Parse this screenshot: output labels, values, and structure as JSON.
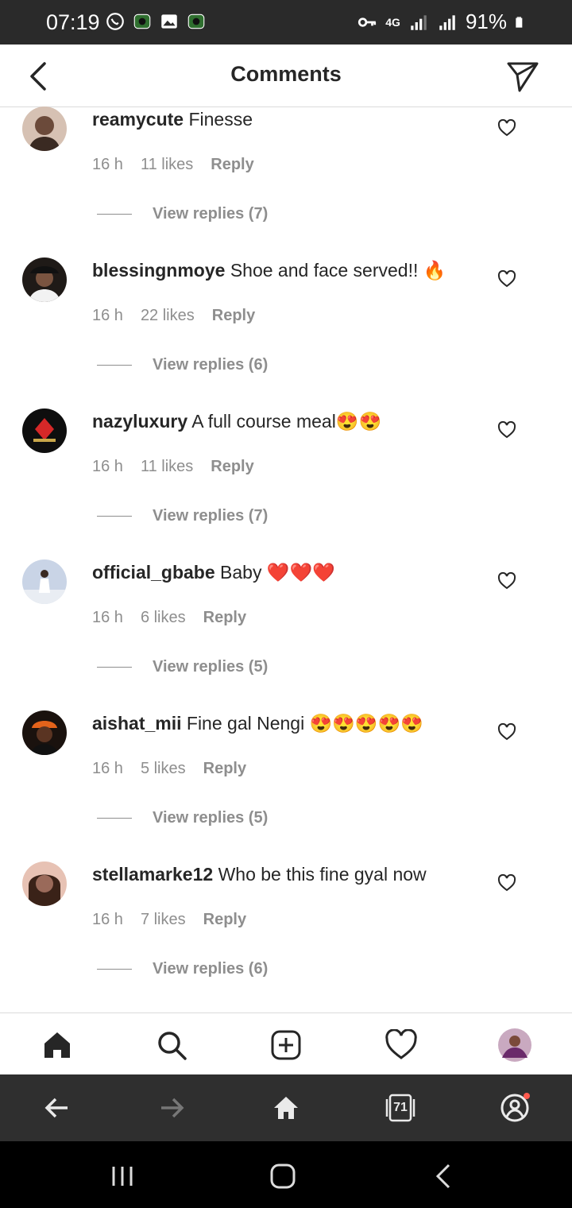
{
  "status_bar": {
    "time": "07:19",
    "battery": "91%",
    "network": "4G",
    "left_icons": [
      "whatsapp-icon",
      "app-icon",
      "gallery-icon",
      "app-icon"
    ],
    "right_icons": [
      "key-icon",
      "signal-icon",
      "signal-icon",
      "battery-icon"
    ]
  },
  "header": {
    "title": "Comments",
    "back_icon": "back-arrow-icon",
    "share_icon": "send-icon"
  },
  "comments": [
    {
      "user": "reamycute",
      "text": " Finesse",
      "time": "16 h",
      "likes": "11 likes",
      "reply": "Reply",
      "view_replies": "View replies (7)",
      "avatar_color": "#6b4a3a"
    },
    {
      "user": "blessingnmoye",
      "text": " Shoe and face served!! 🔥",
      "time": "16 h",
      "likes": "22 likes",
      "reply": "Reply",
      "view_replies": "View replies (6)",
      "avatar_color": "#2b2420"
    },
    {
      "user": "nazyluxury",
      "text": " A full course meal😍😍",
      "time": "16 h",
      "likes": "11 likes",
      "reply": "Reply",
      "view_replies": "View replies (7)",
      "avatar_color": "#111111"
    },
    {
      "user": "official_gbabe",
      "text": " Baby ❤️❤️❤️",
      "time": "16 h",
      "likes": "6 likes",
      "reply": "Reply",
      "view_replies": "View replies (5)",
      "avatar_color": "#c9d4e6"
    },
    {
      "user": "aishat_mii",
      "text": " Fine gal Nengi 😍😍😍😍😍",
      "time": "16 h",
      "likes": "5 likes",
      "reply": "Reply",
      "view_replies": "View replies (5)",
      "avatar_color": "#3a2418"
    },
    {
      "user": "stellamarke12",
      "text": " Who be this fine gyal now",
      "time": "16 h",
      "likes": "7 likes",
      "reply": "Reply",
      "view_replies": "View replies (6)",
      "avatar_color": "#9a6a5a"
    }
  ],
  "ig_nav": {
    "items": [
      "home-icon",
      "search-icon",
      "new-post-icon",
      "activity-heart-icon",
      "profile-avatar"
    ]
  },
  "browser_bar": {
    "tab_count": "71",
    "items": [
      "back-icon",
      "forward-icon",
      "home-icon",
      "tabs-icon",
      "account-icon"
    ]
  },
  "system_nav": {
    "items": [
      "recents-icon",
      "home-icon",
      "back-icon"
    ]
  },
  "colors": {
    "text": "#262626",
    "meta": "#8e8e8e",
    "divider": "#dbdbdb",
    "status_bar_bg": "#2a2a2a",
    "browser_bar_bg": "#2f2f2f"
  }
}
